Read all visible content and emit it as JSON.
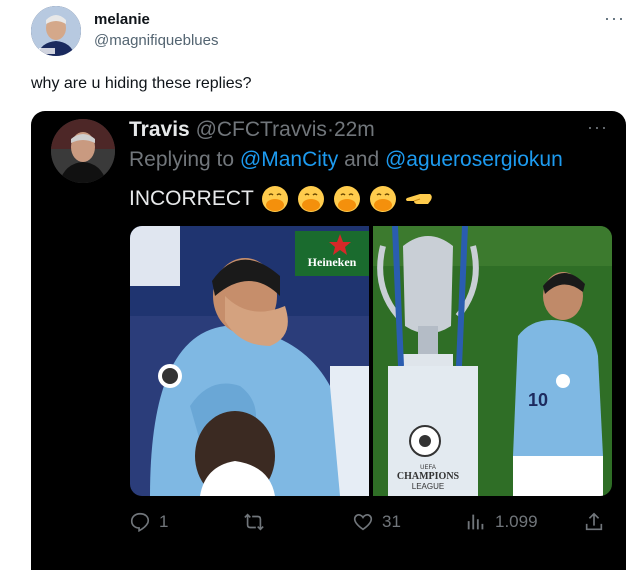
{
  "outer": {
    "display_name": "melanie",
    "handle": "@magnifiqueblues",
    "more_icon": "more-dots-icon",
    "text": "why are u hiding these replies?"
  },
  "quoted": {
    "display_name": "Travis",
    "handle": "@CFCTravvis",
    "separator": "·",
    "time": "22m",
    "replying_prefix": "Replying to",
    "mention_1": "@ManCity",
    "and_word": "and",
    "mention_2": "@aguerosergiokun",
    "text": "INCORRECT",
    "emoji": [
      "face-with-hand-over-mouth",
      "face-with-hand-over-mouth",
      "face-with-hand-over-mouth",
      "face-with-hand-over-mouth",
      "backhand-index-pointing-left"
    ],
    "media": {
      "left_sponsor": "Heineken",
      "right_trophy_text_1": "UEFA",
      "right_trophy_text_2": "CHAMPIONS",
      "right_trophy_text_3": "LEAGUE"
    },
    "actions": {
      "reply_count": "1",
      "retweet_count": "",
      "like_count": "31",
      "views_count": "1.099"
    }
  },
  "colors": {
    "accent_blue": "#1d9bf0",
    "dark_bg": "#000000",
    "muted_gray": "#71767b"
  }
}
